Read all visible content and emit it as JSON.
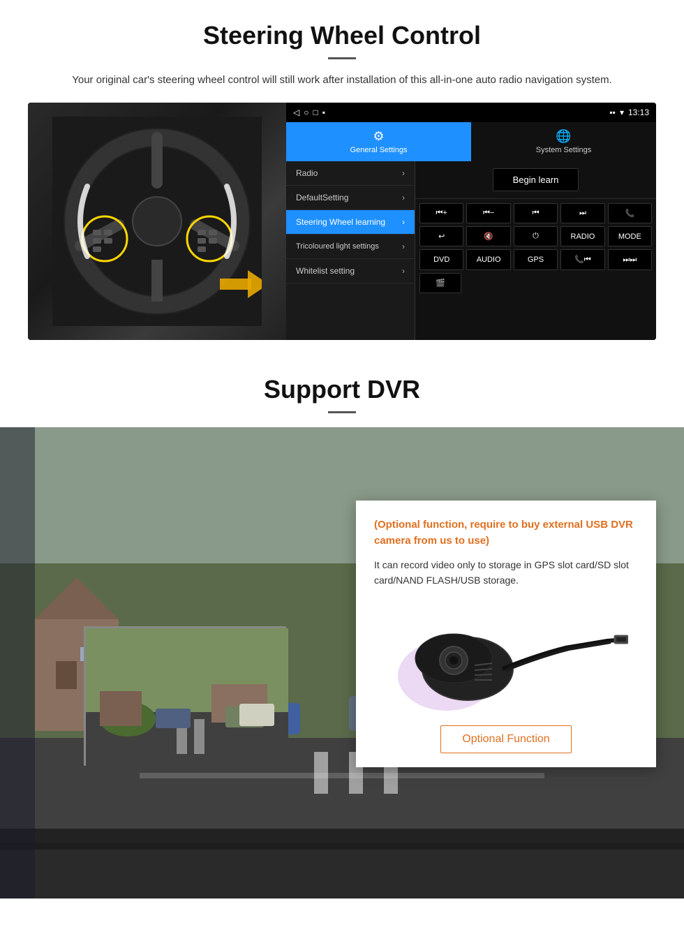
{
  "steering": {
    "title": "Steering Wheel Control",
    "description": "Your original car's steering wheel control will still work after installation of this all-in-one auto radio navigation system.",
    "statusbar": {
      "time": "13:13",
      "signal": "▼",
      "wifi": "▾"
    },
    "nav": {
      "back": "◁",
      "home": "○",
      "recent": "□",
      "menu": "▪"
    },
    "tabs": [
      {
        "icon": "⚙",
        "label": "General Settings",
        "active": true
      },
      {
        "icon": "🌐",
        "label": "System Settings",
        "active": false
      }
    ],
    "menu_items": [
      {
        "label": "Radio",
        "active": false
      },
      {
        "label": "DefaultSetting",
        "active": false
      },
      {
        "label": "Steering Wheel learning",
        "active": true
      },
      {
        "label": "Tricoloured light settings",
        "active": false
      },
      {
        "label": "Whitelist setting",
        "active": false
      }
    ],
    "begin_learn": "Begin learn",
    "control_buttons": [
      [
        "⏮+",
        "⏮−",
        "⏮⏮",
        "⏭⏭",
        "📞"
      ],
      [
        "↩",
        "🔇×",
        "⏻",
        "RADIO",
        "MODE"
      ],
      [
        "DVD",
        "AUDIO",
        "GPS",
        "📞⏮",
        "⏭⏭"
      ],
      [
        "🎬"
      ]
    ]
  },
  "dvr": {
    "title": "Support DVR",
    "card": {
      "title": "(Optional function, require to buy external USB DVR camera from us to use)",
      "description": "It can record video only to storage in GPS slot card/SD slot card/NAND FLASH/USB storage."
    },
    "optional_button": "Optional Function"
  }
}
